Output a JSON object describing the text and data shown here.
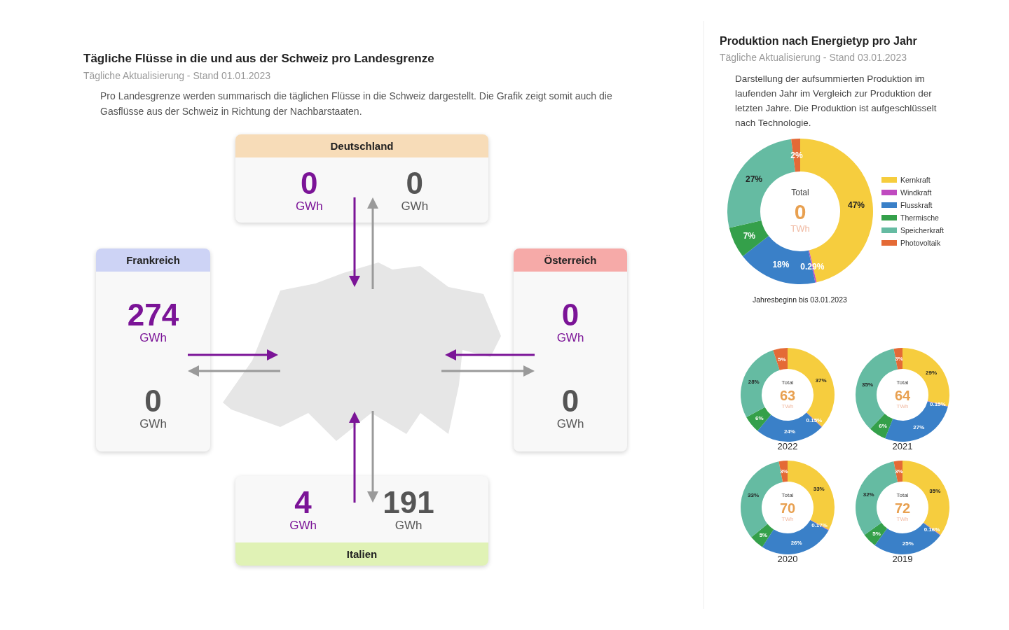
{
  "flows": {
    "title": "Tägliche Flüsse in die und aus der Schweiz pro Landesgrenze",
    "subtitle": "Tägliche Aktualisierung - Stand 01.01.2023",
    "description": "Pro Landesgrenze werden summarisch die täglichen Flüsse in die Schweiz dargestellt. Die Grafik zeigt somit auch die Gasflüsse aus der Schweiz in Richtung der Nachbarstaaten.",
    "borders": [
      {
        "country": "Deutschland",
        "color": "#f7dcb8",
        "import": {
          "value": "0",
          "unit": "GWh"
        },
        "export": {
          "value": "0",
          "unit": "GWh"
        }
      },
      {
        "country": "Frankreich",
        "color": "#cdd3f5",
        "import": {
          "value": "274",
          "unit": "GWh"
        },
        "export": {
          "value": "0",
          "unit": "GWh"
        }
      },
      {
        "country": "Österreich",
        "color": "#f6aaa8",
        "import": {
          "value": "0",
          "unit": "GWh"
        },
        "export": {
          "value": "0",
          "unit": "GWh"
        }
      },
      {
        "country": "Italien",
        "color": "#e0f2b5",
        "import": {
          "value": "4",
          "unit": "GWh"
        },
        "export": {
          "value": "191",
          "unit": "GWh"
        }
      }
    ]
  },
  "production": {
    "title": "Produktion nach Energietyp pro Jahr",
    "subtitle": "Tägliche Aktualisierung - Stand 03.01.2023",
    "description": "Darstellung der aufsummierten Produktion im laufenden Jahr im Vergleich zur Produktion der letzten Jahre. Die Produktion ist aufgeschlüsselt nach Technologie.",
    "current": {
      "center_label": "Total",
      "total": "0",
      "unit": "TWh",
      "caption": "Jahresbeginn bis 03.01.2023",
      "chart_data": {
        "type": "donut",
        "categories": [
          "Kernkraft",
          "Windkraft",
          "Flusskraft",
          "Thermische",
          "Speicherkraft",
          "Photovoltaik"
        ],
        "colors": [
          "#f6cd3e",
          "#c04bc0",
          "#3a80c8",
          "#34a04a",
          "#65bba2",
          "#e46a36"
        ],
        "values": [
          47,
          0.29,
          18,
          7,
          27,
          2
        ],
        "value_labels": [
          "47%",
          "0.29%",
          "18%",
          "7%",
          "27%",
          "2%"
        ],
        "legend": "right"
      }
    },
    "years": [
      {
        "year": "2022",
        "center_label": "Total",
        "total": "63",
        "unit": "TWh",
        "chart_data": {
          "type": "donut",
          "colors": [
            "#f6cd3e",
            "#c04bc0",
            "#3a80c8",
            "#34a04a",
            "#65bba2",
            "#e46a36"
          ],
          "values": [
            37,
            0.15,
            24,
            6,
            28,
            5
          ],
          "value_labels": [
            "37%",
            "0.15%",
            "24%",
            "6%",
            "28%",
            "5%"
          ]
        }
      },
      {
        "year": "2021",
        "center_label": "Total",
        "total": "64",
        "unit": "TWh",
        "chart_data": {
          "type": "donut",
          "colors": [
            "#f6cd3e",
            "#c04bc0",
            "#3a80c8",
            "#34a04a",
            "#65bba2",
            "#e46a36"
          ],
          "values": [
            29,
            0.15,
            27,
            6,
            35,
            3
          ],
          "value_labels": [
            "29%",
            "0.15%",
            "27%",
            "6%",
            "35%",
            "3%"
          ]
        }
      },
      {
        "year": "2020",
        "center_label": "Total",
        "total": "70",
        "unit": "TWh",
        "chart_data": {
          "type": "donut",
          "colors": [
            "#f6cd3e",
            "#c04bc0",
            "#3a80c8",
            "#34a04a",
            "#65bba2",
            "#e46a36"
          ],
          "values": [
            33,
            0.17,
            26,
            5,
            33,
            3
          ],
          "value_labels": [
            "33%",
            "0.17%",
            "26%",
            "5%",
            "33%",
            "3%"
          ]
        }
      },
      {
        "year": "2019",
        "center_label": "Total",
        "total": "72",
        "unit": "TWh",
        "chart_data": {
          "type": "donut",
          "colors": [
            "#f6cd3e",
            "#c04bc0",
            "#3a80c8",
            "#34a04a",
            "#65bba2",
            "#e46a36"
          ],
          "values": [
            35,
            0.16,
            25,
            5,
            32,
            3
          ],
          "value_labels": [
            "35%",
            "0.16%",
            "25%",
            "5%",
            "32%",
            "3%"
          ]
        }
      }
    ]
  }
}
